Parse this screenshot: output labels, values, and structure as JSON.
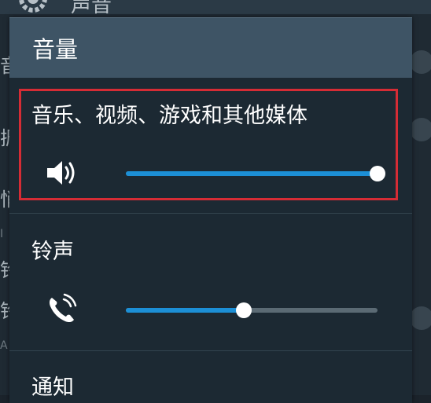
{
  "background": {
    "header_title": "声音",
    "left_fragments": [
      "音",
      "振",
      "悄",
      "I",
      "铃",
      "铃",
      "A"
    ]
  },
  "dialog": {
    "title": "音量",
    "sections": [
      {
        "label": "音乐、视频、游戏和其他媒体",
        "icon": "speaker-volume-icon",
        "level": 1.0
      },
      {
        "label": "铃声",
        "icon": "phone-ring-icon",
        "level": 0.47
      },
      {
        "label": "通知"
      }
    ]
  },
  "colors": {
    "header": "#3e5465",
    "dialog_bg": "#1c2933",
    "slider_active": "#1c8fd6",
    "slider_inactive": "#5b6a74",
    "highlight": "#d52c35"
  }
}
